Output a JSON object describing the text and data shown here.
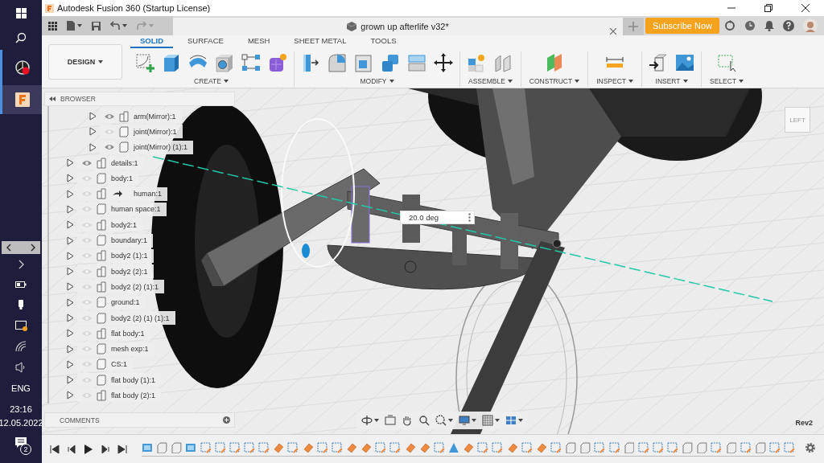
{
  "taskbar": {
    "language": "ENG",
    "time": "23:16",
    "date": "12.05.2022",
    "notification_count": "2"
  },
  "window": {
    "title": "Autodesk Fusion 360 (Startup License)"
  },
  "document_tab": {
    "title": "grown up afterlife v32*"
  },
  "subscribe_button": {
    "label": "Subscribe Now"
  },
  "workspace": {
    "label": "DESIGN"
  },
  "toolbar_tabs": [
    {
      "label": "SOLID",
      "selected": true
    },
    {
      "label": "SURFACE",
      "selected": false
    },
    {
      "label": "MESH",
      "selected": false
    },
    {
      "label": "SHEET METAL",
      "selected": false
    },
    {
      "label": "TOOLS",
      "selected": false
    }
  ],
  "tool_groups": [
    {
      "label": "CREATE"
    },
    {
      "label": "MODIFY"
    },
    {
      "label": "ASSEMBLE"
    },
    {
      "label": "CONSTRUCT"
    },
    {
      "label": "INSPECT"
    },
    {
      "label": "INSERT"
    },
    {
      "label": "SELECT"
    }
  ],
  "browser": {
    "title": "BROWSER",
    "items": [
      {
        "children": [
          {
            "label": "arm(Mirror):1",
            "kind": "assembly",
            "visible": true,
            "linked": false,
            "expanded": false
          },
          {
            "label": "joint(Mirror):1",
            "kind": "part",
            "visible": false,
            "linked": false,
            "expanded": false
          },
          {
            "label": "joint(Mirror) (1):1",
            "kind": "part",
            "visible": true,
            "linked": false,
            "expanded": false
          }
        ]
      },
      {
        "label": "details:1",
        "kind": "assembly",
        "visible": true,
        "linked": false,
        "expanded": false
      },
      {
        "label": "body:1",
        "kind": "part",
        "visible": false,
        "linked": false,
        "expanded": false
      },
      {
        "label": "human:1",
        "kind": "assembly",
        "visible": false,
        "linked": true,
        "expanded": false
      },
      {
        "label": "human space:1",
        "kind": "part",
        "visible": false,
        "linked": false,
        "expanded": false
      },
      {
        "label": "body2:1",
        "kind": "assembly",
        "visible": false,
        "linked": false,
        "expanded": false
      },
      {
        "label": "boundary:1",
        "kind": "part",
        "visible": false,
        "linked": false,
        "expanded": false
      },
      {
        "label": "body2 (1):1",
        "kind": "assembly",
        "visible": false,
        "linked": false,
        "expanded": false
      },
      {
        "label": "body2 (2):1",
        "kind": "assembly",
        "visible": false,
        "linked": false,
        "expanded": false
      },
      {
        "label": "body2 (2) (1):1",
        "kind": "assembly",
        "visible": false,
        "linked": false,
        "expanded": false
      },
      {
        "label": "ground:1",
        "kind": "part",
        "visible": false,
        "linked": false,
        "expanded": false
      },
      {
        "label": "body2 (2) (1) (1):1",
        "kind": "part",
        "visible": false,
        "linked": false,
        "expanded": false
      },
      {
        "label": "flat body:1",
        "kind": "assembly",
        "visible": false,
        "linked": false,
        "expanded": false
      },
      {
        "label": "mesh exp:1",
        "kind": "part",
        "visible": false,
        "linked": false,
        "expanded": false
      },
      {
        "label": "CS:1",
        "kind": "part",
        "visible": false,
        "linked": false,
        "expanded": false
      },
      {
        "label": "flat body (1):1",
        "kind": "part",
        "visible": false,
        "linked": false,
        "expanded": false
      },
      {
        "label": "flat body (2):1",
        "kind": "assembly",
        "visible": false,
        "linked": false,
        "expanded": false
      }
    ]
  },
  "angle_input": {
    "value": "20.0 deg"
  },
  "view_cube": {
    "face": "LEFT"
  },
  "revision": "Rev2",
  "comments": {
    "title": "COMMENTS"
  }
}
